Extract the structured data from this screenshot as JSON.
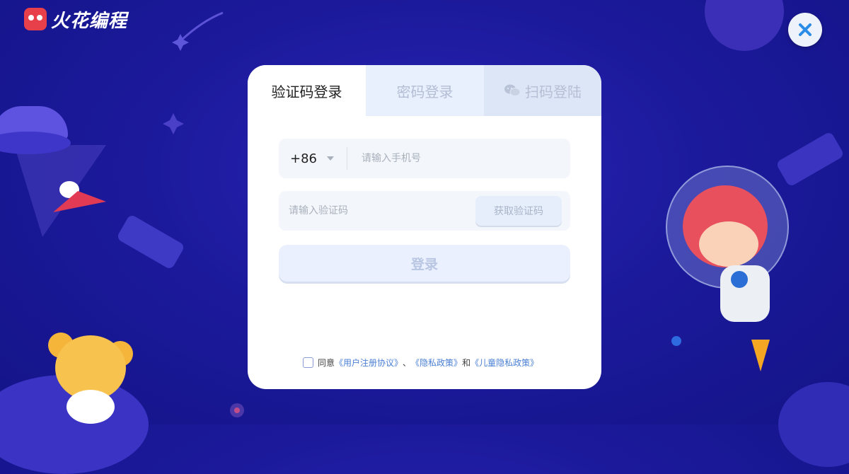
{
  "app": {
    "logo_text": "火花编程"
  },
  "tabs": [
    {
      "label": "验证码登录",
      "active": true
    },
    {
      "label": "密码登录",
      "active": false
    },
    {
      "label": "扫码登陆",
      "active": false
    }
  ],
  "phone": {
    "country_code": "+86",
    "placeholder": "请输入手机号"
  },
  "code": {
    "placeholder": "请输入验证码",
    "get_code_label": "获取验证码"
  },
  "login_label": "登录",
  "agreement": {
    "prefix": "同意",
    "user_agreement": "《用户注册协议》",
    "sep": "、",
    "privacy": "《隐私政策》",
    "and": "和",
    "child_privacy": "《儿童隐私政策》",
    "checked": false
  },
  "colors": {
    "background": "#1c1a9c",
    "card": "#ffffff",
    "link": "#4a7fd4",
    "close_icon": "#2a8ce6"
  },
  "icons": [
    "close-icon",
    "chevron-down-icon",
    "wechat-icon"
  ]
}
